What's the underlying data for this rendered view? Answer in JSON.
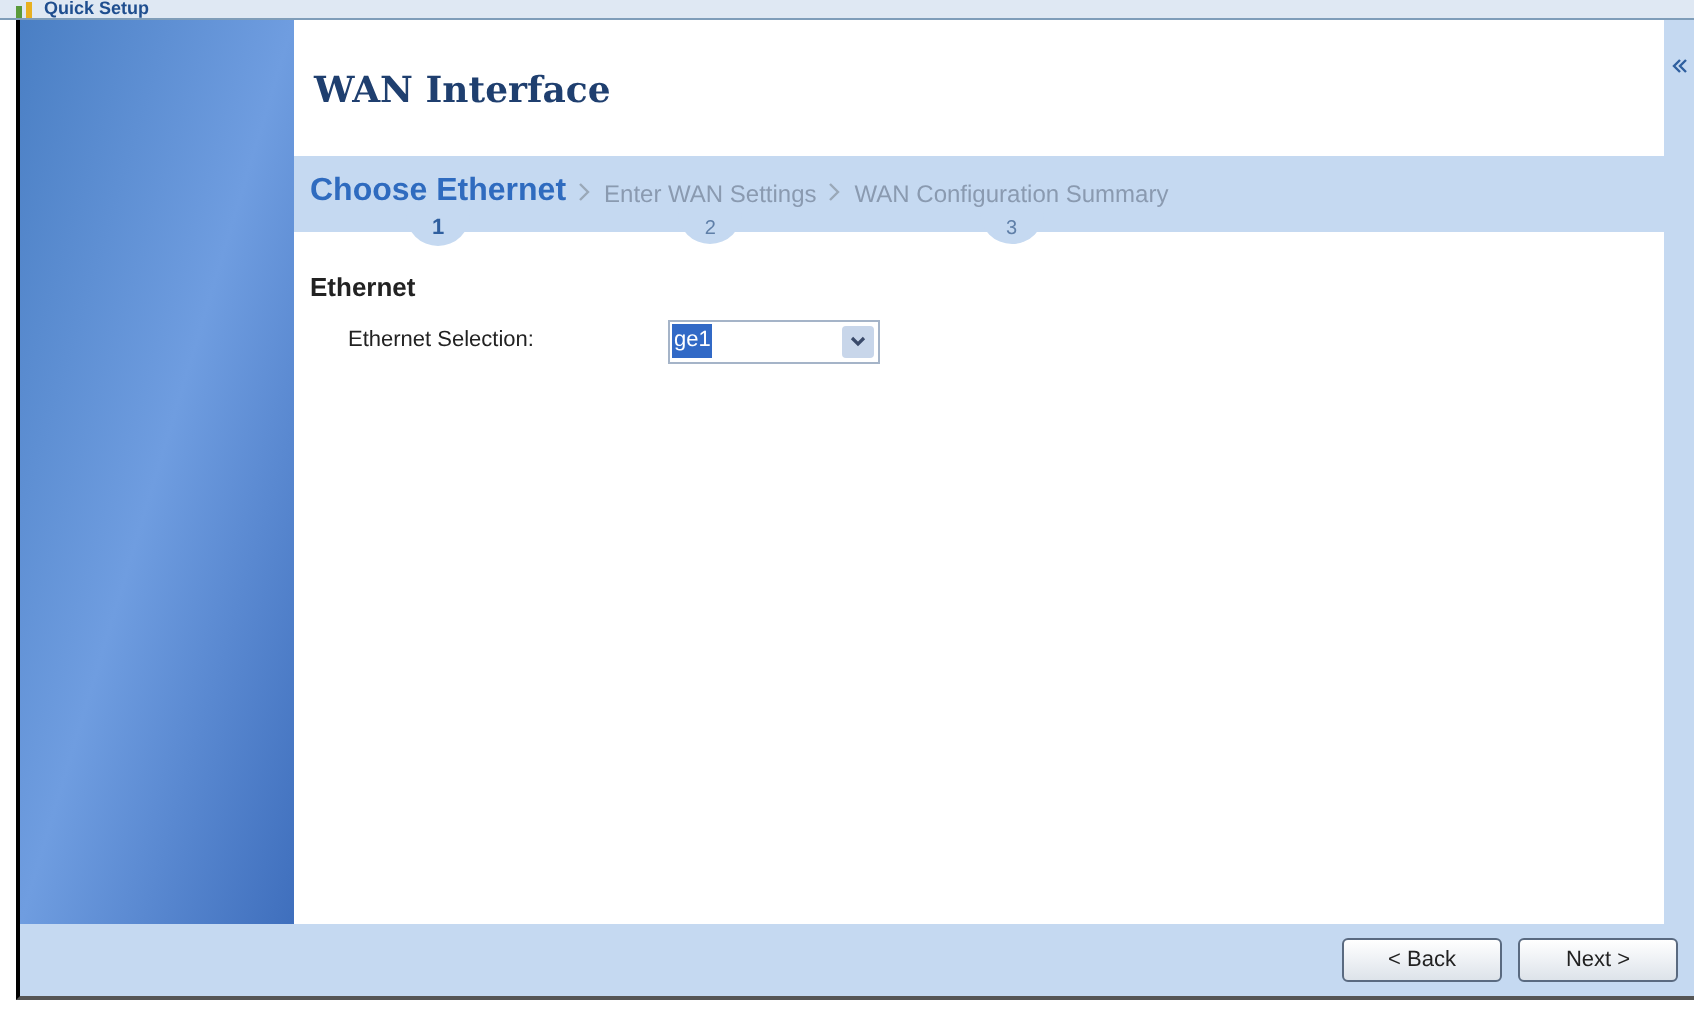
{
  "window": {
    "title": "Quick Setup"
  },
  "page_title": "WAN Interface",
  "steps": [
    {
      "label": "Choose Ethernet",
      "number": "1",
      "selected": true
    },
    {
      "label": "Enter WAN Settings",
      "number": "2",
      "selected": false
    },
    {
      "label": "WAN Configuration Summary",
      "number": "3",
      "selected": false
    }
  ],
  "section": {
    "title": "Ethernet",
    "fields": [
      {
        "label": "Ethernet Selection:",
        "value": "ge1"
      }
    ]
  },
  "buttons": [
    {
      "label": "< Back"
    },
    {
      "label": "Next >"
    }
  ]
}
